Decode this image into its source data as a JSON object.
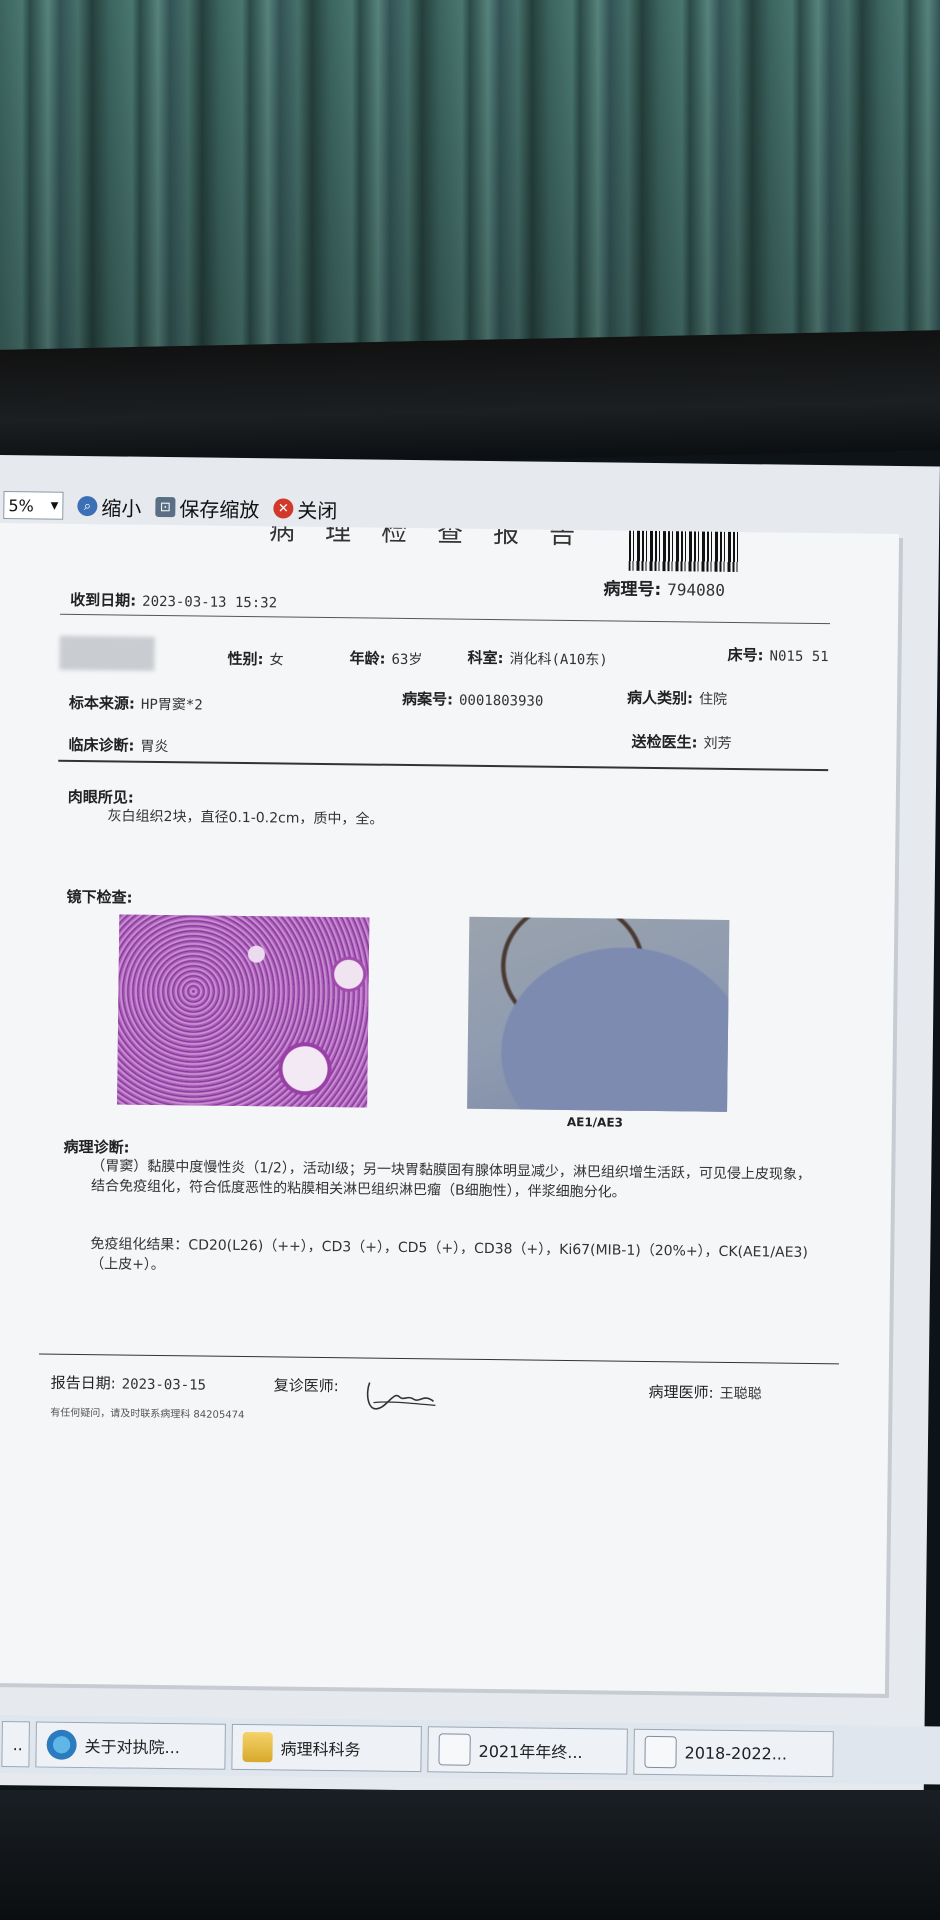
{
  "toolbar": {
    "zoom_value": "5%",
    "zoom_out_label": "缩小",
    "save_zoom_label": "保存缩放",
    "close_label": "关闭"
  },
  "report": {
    "pathology_no_label": "病理号:",
    "pathology_no": "794080",
    "received_label": "收到日期:",
    "received_date": "2023-03-13 15:32",
    "gender_label": "性别:",
    "gender": "女",
    "age_label": "年龄:",
    "age": "63岁",
    "dept_label": "科室:",
    "dept": "消化科(A10东)",
    "bed_label": "床号:",
    "bed": "N015 51",
    "specimen_label": "标本来源:",
    "specimen": "HP胃窦*2",
    "case_no_label": "病案号:",
    "case_no": "0001803930",
    "patient_type_label": "病人类别:",
    "patient_type": "住院",
    "clinical_dx_label": "临床诊断:",
    "clinical_dx": "胃炎",
    "sender_label": "送检医生:",
    "sender": "刘芳",
    "gross_label": "肉眼所见:",
    "gross_text": "灰白组织2块，直径0.1-0.2cm，质中，全。",
    "micro_label": "镜下检查:",
    "ihc_caption": "AE1/AE3",
    "dx_label": "病理诊断:",
    "dx_text": "（胃窦）黏膜中度慢性炎（1/2），活动I级；另一块胃黏膜固有腺体明显减少，淋巴组织增生活跃，可见侵上皮现象，结合免疫组化，符合低度恶性的粘膜相关淋巴组织淋巴瘤（B细胞性），伴浆细胞分化。",
    "ihc_text": "免疫组化结果：CD20(L26)（++），CD3（+），CD5（+），CD38（+），Ki67(MIB-1)（20%+），CK(AE1/AE3)（上皮+）。",
    "report_date_label": "报告日期:",
    "report_date": "2023-03-15",
    "review_label": "复诊医师:",
    "pathologist_label": "病理医师:",
    "pathologist": "王聪聪",
    "footer_note": "有任何疑问，请及时联系病理科 84205474"
  },
  "taskbar": {
    "items": [
      {
        "label": "关于对执院..."
      },
      {
        "label": "病理科科务"
      },
      {
        "label": "2021年年终..."
      },
      {
        "label": "2018-2022..."
      }
    ]
  }
}
